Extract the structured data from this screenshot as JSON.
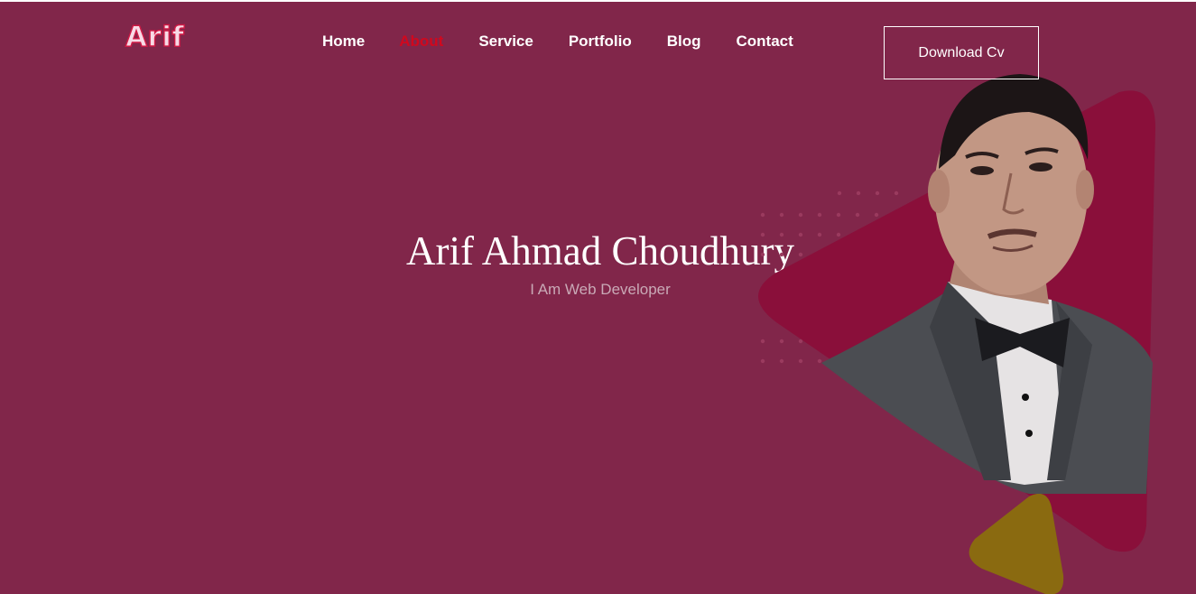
{
  "brand": {
    "logo_text": "Arif"
  },
  "nav": {
    "items": [
      {
        "label": "Home",
        "active": false
      },
      {
        "label": "About",
        "active": true
      },
      {
        "label": "Service",
        "active": false
      },
      {
        "label": "Portfolio",
        "active": false
      },
      {
        "label": "Blog",
        "active": false
      },
      {
        "label": "Contact",
        "active": false
      }
    ]
  },
  "header": {
    "cta_label": "Download Cv"
  },
  "hero": {
    "name": "Arif Ahmad Choudhury",
    "tagline": "I Am Web Developer"
  },
  "colors": {
    "background": "#81264a",
    "nav_active": "#d1081e",
    "accent_shape": "#8a0f3a",
    "accent_yellow": "#8a6a10"
  }
}
